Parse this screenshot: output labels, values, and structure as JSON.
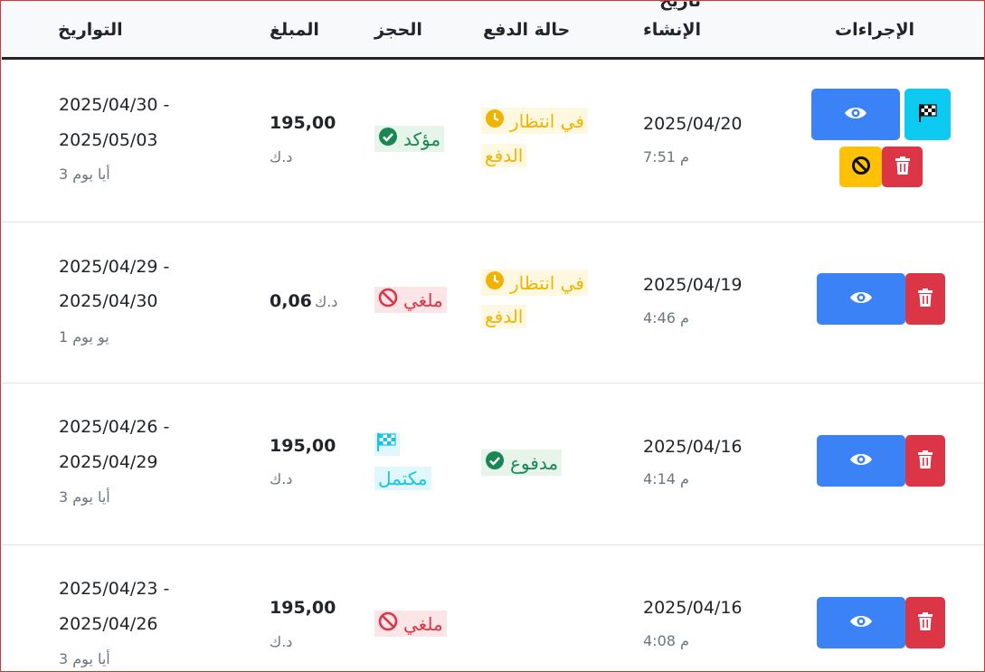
{
  "headers": {
    "dates": "التواريخ",
    "amount": "المبلغ",
    "booking": "الحجز",
    "payment_status": "حالة الدفع",
    "created_clip": "تاريخ",
    "created": "الإنشاء",
    "actions": "الإجراءات"
  },
  "rows": [
    {
      "date_from": "2025/04/30 -",
      "date_to": "2025/05/03",
      "days": "3 أيا يوم",
      "amount": "195,00",
      "currency": "د.ك",
      "booking_status": "مؤكد",
      "payment_status_line1": "في انتظار",
      "payment_status_line2": "الدفع",
      "created_date": "2025/04/20",
      "created_time": "7:51 م"
    },
    {
      "date_from": "2025/04/29 -",
      "date_to": "2025/04/30",
      "days": "1 يو يوم",
      "amount": "0,06",
      "currency": "د.ك",
      "booking_status": "ملغي",
      "payment_status_line1": "في انتظار",
      "payment_status_line2": "الدفع",
      "created_date": "2025/04/19",
      "created_time": "4:46 م"
    },
    {
      "date_from": "2025/04/26 -",
      "date_to": "2025/04/29",
      "days": "3 أيا يوم",
      "amount": "195,00",
      "currency": "د.ك",
      "booking_status": "مكتمل",
      "payment_status": "مدفوع",
      "created_date": "2025/04/16",
      "created_time": "4:14 م"
    },
    {
      "date_from": "2025/04/23 -",
      "date_to": "2025/04/26",
      "days": "3 أيا يوم",
      "amount": "195,00",
      "currency": "د.ك",
      "booking_status": "ملغي",
      "created_date": "2025/04/16",
      "created_time": "4:08 م"
    }
  ],
  "colors": {
    "view_button": "#3b82f6",
    "delete_button": "#dc3545",
    "finish_button": "#0dcaf0",
    "cancel_button": "#ffc107",
    "confirmed": "#198754",
    "cancelled": "#dc3545",
    "pending": "#f0b400",
    "completed": "#17c3e6"
  },
  "icons": [
    "eye-icon",
    "trash-icon",
    "checkered-flag-icon",
    "ban-icon",
    "check-circle-icon",
    "clock-icon"
  ]
}
